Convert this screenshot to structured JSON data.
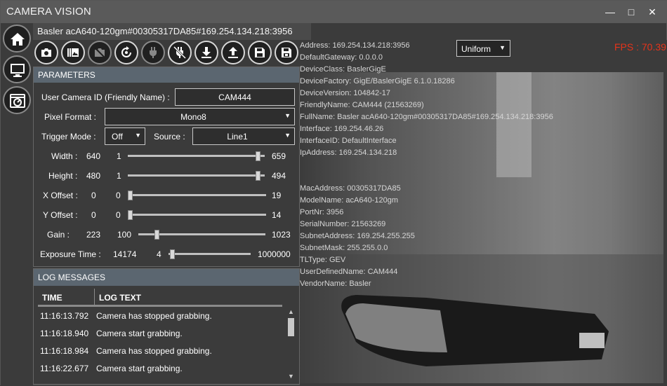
{
  "app": {
    "title": "CAMERA VISION"
  },
  "window_controls": {
    "minimize": "—",
    "maximize": "□",
    "close": "✕"
  },
  "nav": [
    {
      "name": "home-icon"
    },
    {
      "name": "monitor-icon"
    },
    {
      "name": "camera-settings-icon"
    }
  ],
  "device": {
    "header": "Basler acA640-120gm#00305317DA85#169.254.134.218:3956"
  },
  "toolbar": [
    {
      "name": "snapshot-icon",
      "enabled": true
    },
    {
      "name": "continuous-grab-icon",
      "enabled": true
    },
    {
      "name": "stop-grab-icon",
      "enabled": false
    },
    {
      "name": "refresh-icon",
      "enabled": true
    },
    {
      "name": "connect-icon",
      "enabled": false
    },
    {
      "name": "disconnect-icon",
      "enabled": true
    },
    {
      "name": "download-icon",
      "enabled": true
    },
    {
      "name": "upload-icon",
      "enabled": true
    },
    {
      "name": "save-icon",
      "enabled": true
    },
    {
      "name": "save-as-icon",
      "enabled": true
    }
  ],
  "parameters": {
    "heading": "PARAMETERS",
    "user_camera_id_label": "User Camera ID (Friendly Name) :",
    "user_camera_id_value": "CAM444",
    "pixel_format_label": "Pixel Format :",
    "pixel_format_value": "Mono8",
    "trigger_mode_label": "Trigger Mode :",
    "trigger_mode_value": "Off",
    "source_label": "Source :",
    "source_value": "Line1",
    "width": {
      "label": "Width :",
      "value": "640",
      "min": "1",
      "max": "659",
      "level": 0.97
    },
    "height": {
      "label": "Height :",
      "value": "480",
      "min": "1",
      "max": "494",
      "level": 0.97
    },
    "x_offset": {
      "label": "X Offset :",
      "value": "0",
      "min": "0",
      "max": "19",
      "level": 0.0
    },
    "y_offset": {
      "label": "Y Offset :",
      "value": "0",
      "min": "0",
      "max": "14",
      "level": 0.0
    },
    "gain": {
      "label": "Gain :",
      "value": "223",
      "min": "100",
      "max": "1023",
      "level": 0.13
    },
    "exposure": {
      "label": "Exposure Time :",
      "value": "14174",
      "min": "4",
      "max": "1000000",
      "level": 0.014
    }
  },
  "log": {
    "heading": "LOG MESSAGES",
    "col_time": "TIME",
    "col_text": "LOG TEXT",
    "rows": [
      {
        "time": "11:16:13.792",
        "text": "Camera has stopped grabbing."
      },
      {
        "time": "11:16:18.940",
        "text": "Camera start grabbing."
      },
      {
        "time": "11:16:18.984",
        "text": "Camera has stopped grabbing."
      },
      {
        "time": "11:16:22.677",
        "text": "Camera start grabbing."
      }
    ]
  },
  "viewer": {
    "mode_value": "Uniform",
    "fps_text": "FPS : 70.39",
    "info_lines": [
      "Address: 169.254.134.218:3956",
      "DefaultGateway: 0.0.0.0",
      "DeviceClass: BaslerGigE",
      "DeviceFactory: GigE/BaslerGigE 6.1.0.18286",
      "DeviceVersion: 104842-17",
      "FriendlyName: CAM444 (21563269)",
      "FullName: Basler acA640-120gm#00305317DA85#169.254.134.218:3956",
      "Interface: 169.254.46.26",
      "InterfaceID: DefaultInterface",
      "IpAddress: 169.254.134.218",
      "",
      "",
      "MacAddress: 00305317DA85",
      "ModelName: acA640-120gm",
      "PortNr: 3956",
      "SerialNumber: 21563269",
      "SubnetAddress: 169.254.255.255",
      "SubnetMask: 255.255.0.0",
      "TLType: GEV",
      "UserDefinedName: CAM444",
      "VendorName: Basler"
    ]
  }
}
